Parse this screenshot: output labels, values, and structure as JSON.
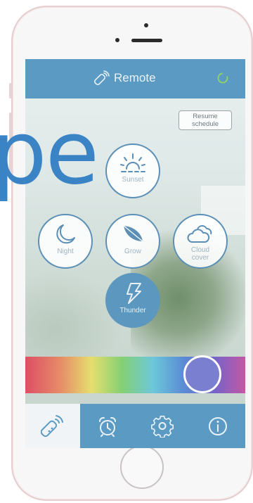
{
  "app": {
    "title": "Remote"
  },
  "schedule": {
    "resume_label_line1": "Resume",
    "resume_label_line2": "schedule"
  },
  "modes": [
    {
      "label": "Sunset",
      "icon": "sunset-icon",
      "active": false
    },
    {
      "label": "Night",
      "icon": "moon-icon",
      "active": false
    },
    {
      "label": "Grow",
      "icon": "leaf-icon",
      "active": false
    },
    {
      "label_line1": "Cloud",
      "label_line2": "cover",
      "icon": "cloud-icon",
      "active": false
    },
    {
      "label": "Thunder",
      "icon": "lightning-icon",
      "active": true
    }
  ],
  "tabs": [
    {
      "name": "remote",
      "icon": "remote-icon",
      "active": true
    },
    {
      "name": "schedule",
      "icon": "alarm-clock-icon",
      "active": false
    },
    {
      "name": "settings",
      "icon": "gear-icon",
      "active": false
    },
    {
      "name": "info",
      "icon": "info-icon",
      "active": false
    }
  ],
  "overlay_text": "pe",
  "colors": {
    "accent": "#5b9bc3",
    "active_mode": "#5b97bf",
    "overlay_text": "#3a83c4"
  }
}
